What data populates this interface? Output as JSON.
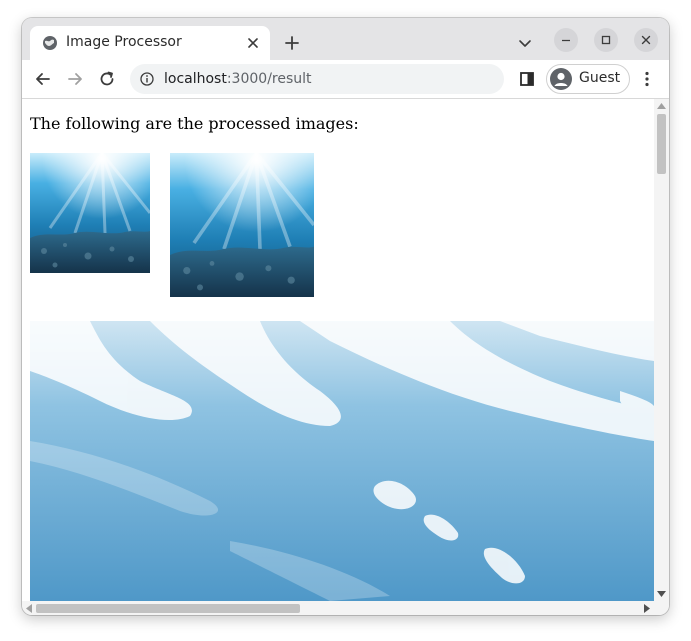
{
  "browser": {
    "tab": {
      "title": "Image Processor",
      "icon": "globe-icon"
    },
    "new_tab_icon": "plus-icon",
    "address": {
      "host": "localhost",
      "path": ":3000/result"
    },
    "profile": {
      "label": "Guest"
    },
    "colors": {
      "tabstrip": "#e4e4e6",
      "omnibox": "#f1f3f4"
    }
  },
  "page": {
    "caption": "The following are the processed images:",
    "images": [
      {
        "name": "processed-image-small",
        "description": "underwater seabed with sunlight rays"
      },
      {
        "name": "processed-image-medium",
        "description": "underwater seabed with sunlight rays"
      },
      {
        "name": "processed-image-large",
        "description": "close-up of light caustics on water"
      }
    ]
  }
}
